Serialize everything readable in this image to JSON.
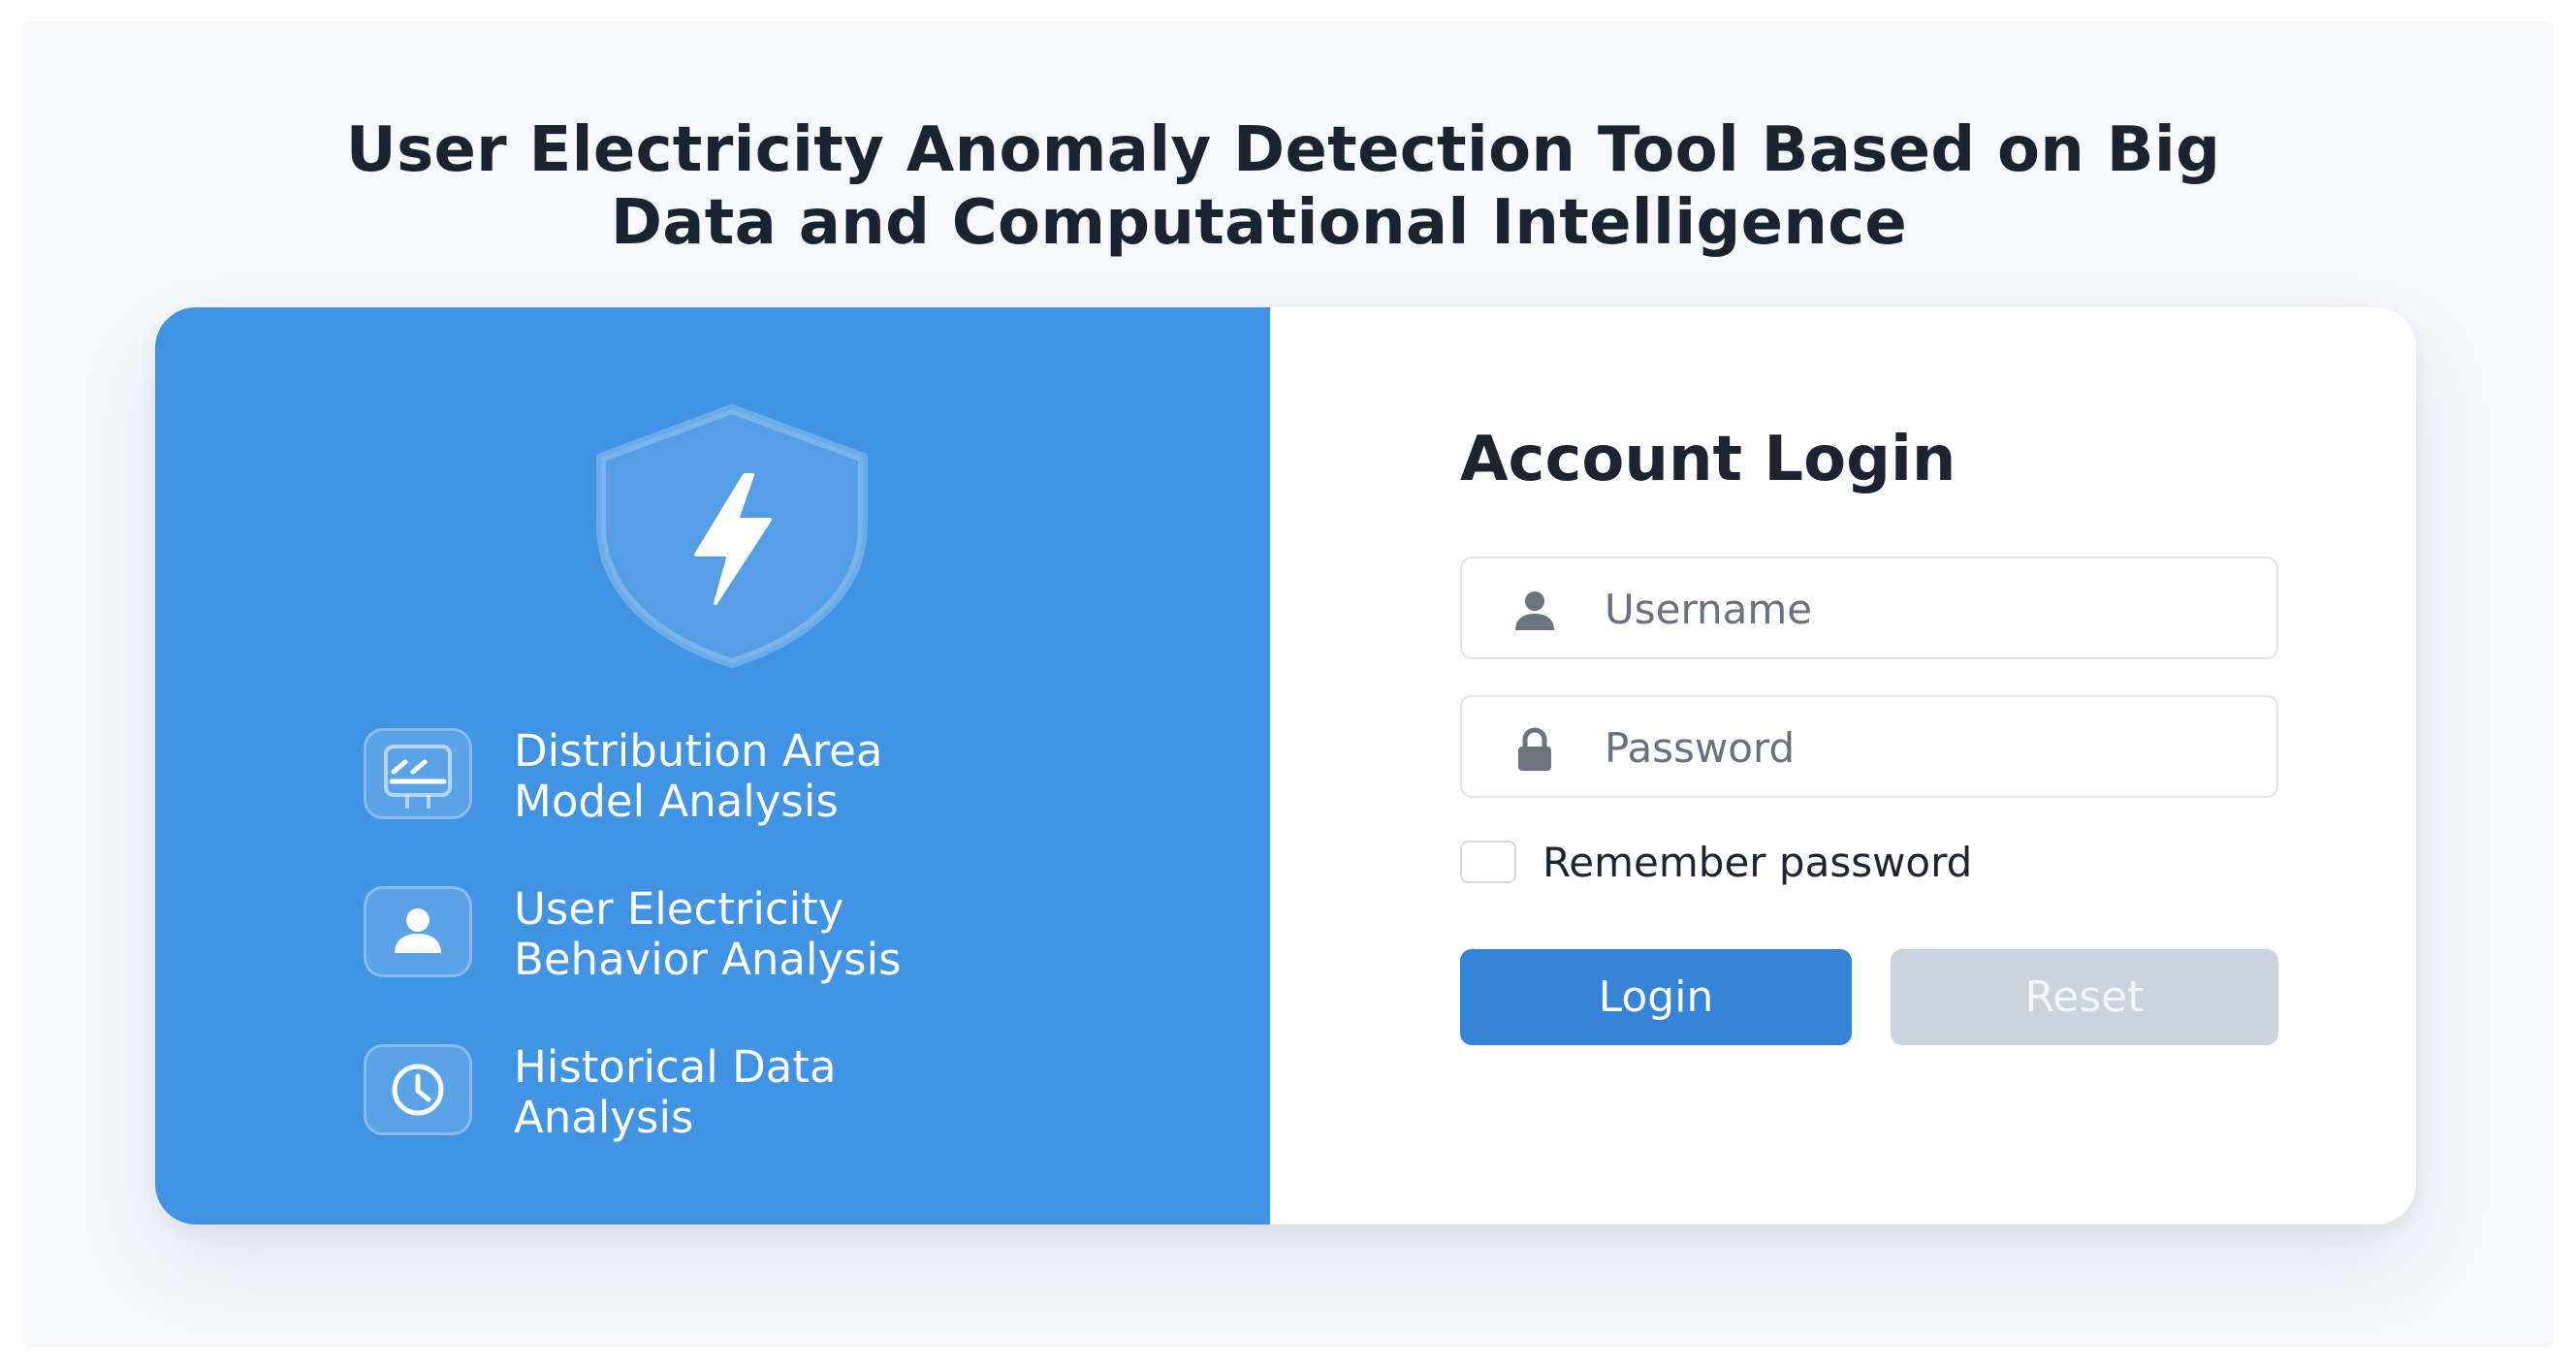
{
  "page": {
    "title_line1": "User Electricity Anomaly Detection Tool Based on Big",
    "title_line2": "Data and Computational Intelligence"
  },
  "features": [
    {
      "line1": "Distribution Area",
      "line2": "Model Analysis",
      "icon": "distribution-area-icon"
    },
    {
      "line1": "User Electricity",
      "line2": "Behavior Analysis",
      "icon": "user-icon"
    },
    {
      "line1": "Historical Data",
      "line2": "Analysis",
      "icon": "clock-icon"
    }
  ],
  "login": {
    "title": "Account Login",
    "username_placeholder": "Username",
    "password_placeholder": "Password",
    "remember_label": "Remember password",
    "remember_checked": false,
    "login_button": "Login",
    "reset_button": "Reset"
  },
  "colors": {
    "panel_blue": "#4194e3",
    "login_button": "#3584d8",
    "reset_button": "#cdd3dc"
  }
}
